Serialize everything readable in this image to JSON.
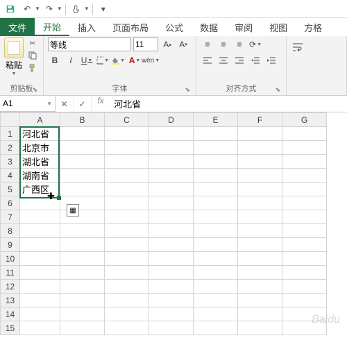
{
  "qat": {
    "save": "save",
    "undo": "undo",
    "redo": "redo",
    "touch": "touch"
  },
  "tabs": {
    "file": "文件",
    "items": [
      "开始",
      "插入",
      "页面布局",
      "公式",
      "数据",
      "审阅",
      "视图",
      "方格"
    ],
    "active": 0
  },
  "ribbon": {
    "clipboard": {
      "label": "剪贴板",
      "paste": "粘贴"
    },
    "font": {
      "label": "字体",
      "name": "等线",
      "size": "11",
      "bold": "B",
      "italic": "I",
      "underline": "U",
      "wen": "wén"
    },
    "align": {
      "label": "对齐方式"
    }
  },
  "namebox": "A1",
  "formula": "河北省",
  "columns": [
    "A",
    "B",
    "C",
    "D",
    "E",
    "F",
    "G"
  ],
  "rows": [
    "1",
    "2",
    "3",
    "4",
    "5",
    "6",
    "7",
    "8",
    "9",
    "10",
    "11",
    "12",
    "13",
    "14",
    "15"
  ],
  "cells": {
    "A1": "河北省",
    "A2": "北京市",
    "A3": "湖北省",
    "A4": "湖南省",
    "A5": "广西区"
  },
  "watermark": "Baidu"
}
